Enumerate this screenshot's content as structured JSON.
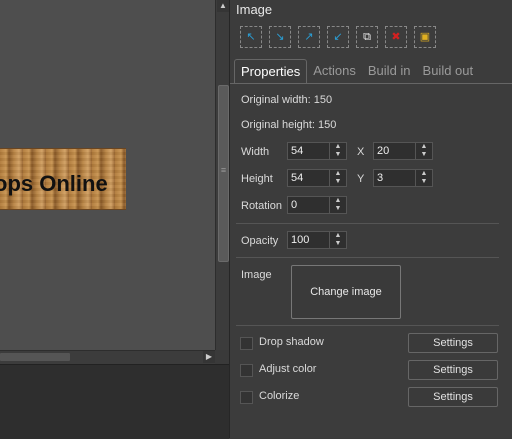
{
  "canvas": {
    "banner_text": "ops Online"
  },
  "panel": {
    "title": "Image",
    "toolbar": [
      {
        "icon": "align-up-icon",
        "glyph": "⬏"
      },
      {
        "icon": "align-down-icon",
        "glyph": "⬎"
      },
      {
        "icon": "bring-front-icon",
        "glyph": "⬆"
      },
      {
        "icon": "send-back-icon",
        "glyph": "⬇"
      },
      {
        "icon": "duplicate-icon",
        "glyph": "⧉"
      },
      {
        "icon": "delete-icon",
        "glyph": "✖"
      },
      {
        "icon": "lock-icon",
        "glyph": "🔒"
      }
    ],
    "tabs": {
      "properties": "Properties",
      "actions": "Actions",
      "build_in": "Build in",
      "build_out": "Build out"
    },
    "original_width": "Original width: 150",
    "original_height": "Original height: 150",
    "width_label": "Width",
    "width_value": "54",
    "x_label": "X",
    "x_value": "20",
    "height_label": "Height",
    "height_value": "54",
    "y_label": "Y",
    "y_value": "3",
    "rotation_label": "Rotation",
    "rotation_value": "0",
    "opacity_label": "Opacity",
    "opacity_value": "100",
    "image_label": "Image",
    "change_image": "Change image",
    "drop_shadow": "Drop shadow",
    "adjust_color": "Adjust color",
    "colorize": "Colorize",
    "settings_label": "Settings"
  }
}
